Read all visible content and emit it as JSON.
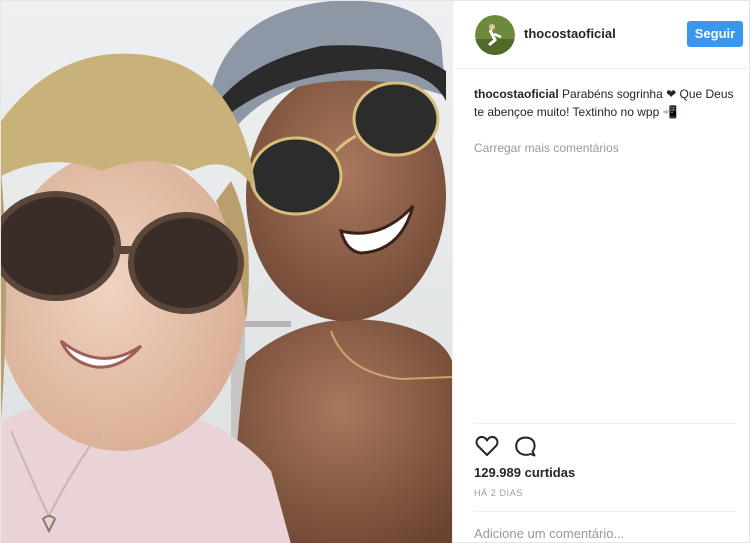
{
  "header": {
    "username": "thocostaoficial",
    "follow_label": "Seguir"
  },
  "caption": {
    "username": "thocostaoficial",
    "text": "Parabéns sogrinha ❤ Que Deus te abençoe muito! Textinho no wpp 📲"
  },
  "comments": {
    "load_more": "Carregar mais comentários"
  },
  "actions": {
    "like_icon": "heart-outline",
    "comment_icon": "speech-bubble-outline"
  },
  "likes": "129.989 curtidas",
  "timestamp": "HÁ 2 DIAS",
  "add_comment": {
    "placeholder": "Adicione um comentário..."
  },
  "colors": {
    "accent": "#3897f0",
    "muted_text": "#999999",
    "text": "#262626"
  }
}
